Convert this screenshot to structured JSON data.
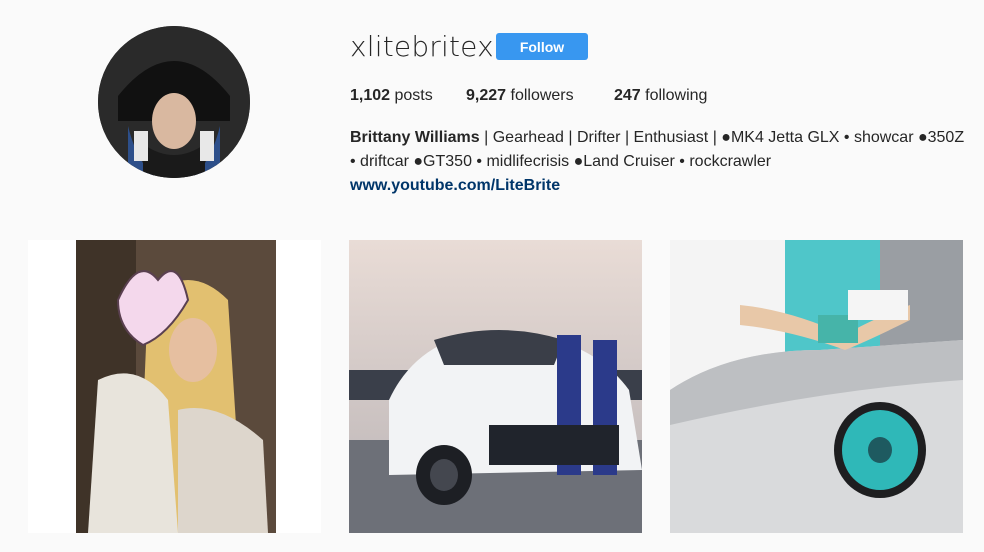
{
  "profile": {
    "username": "xlitebritex",
    "follow_label": "Follow"
  },
  "stats": {
    "posts_count": "1,102",
    "posts_label": "posts",
    "followers_count": "9,227",
    "followers_label": "followers",
    "following_count": "247",
    "following_label": "following"
  },
  "bio": {
    "name": "Brittany Williams",
    "text": "| Gearhead | Drifter | Enthusiast | ●MK4 Jetta GLX • showcar ●350Z • driftcar ●GT350 • midlifecrisis ●Land Cruiser • rockcrawler",
    "link": "www.youtube.com/LiteBrite"
  },
  "posts": [
    {
      "subject": "woman-with-heart-sticker"
    },
    {
      "subject": "white-mustang-gt350"
    },
    {
      "subject": "woman-on-silver-jetta"
    }
  ],
  "colors": {
    "follow_button": "#3897f0",
    "link": "#003569",
    "background": "#fafafa"
  }
}
